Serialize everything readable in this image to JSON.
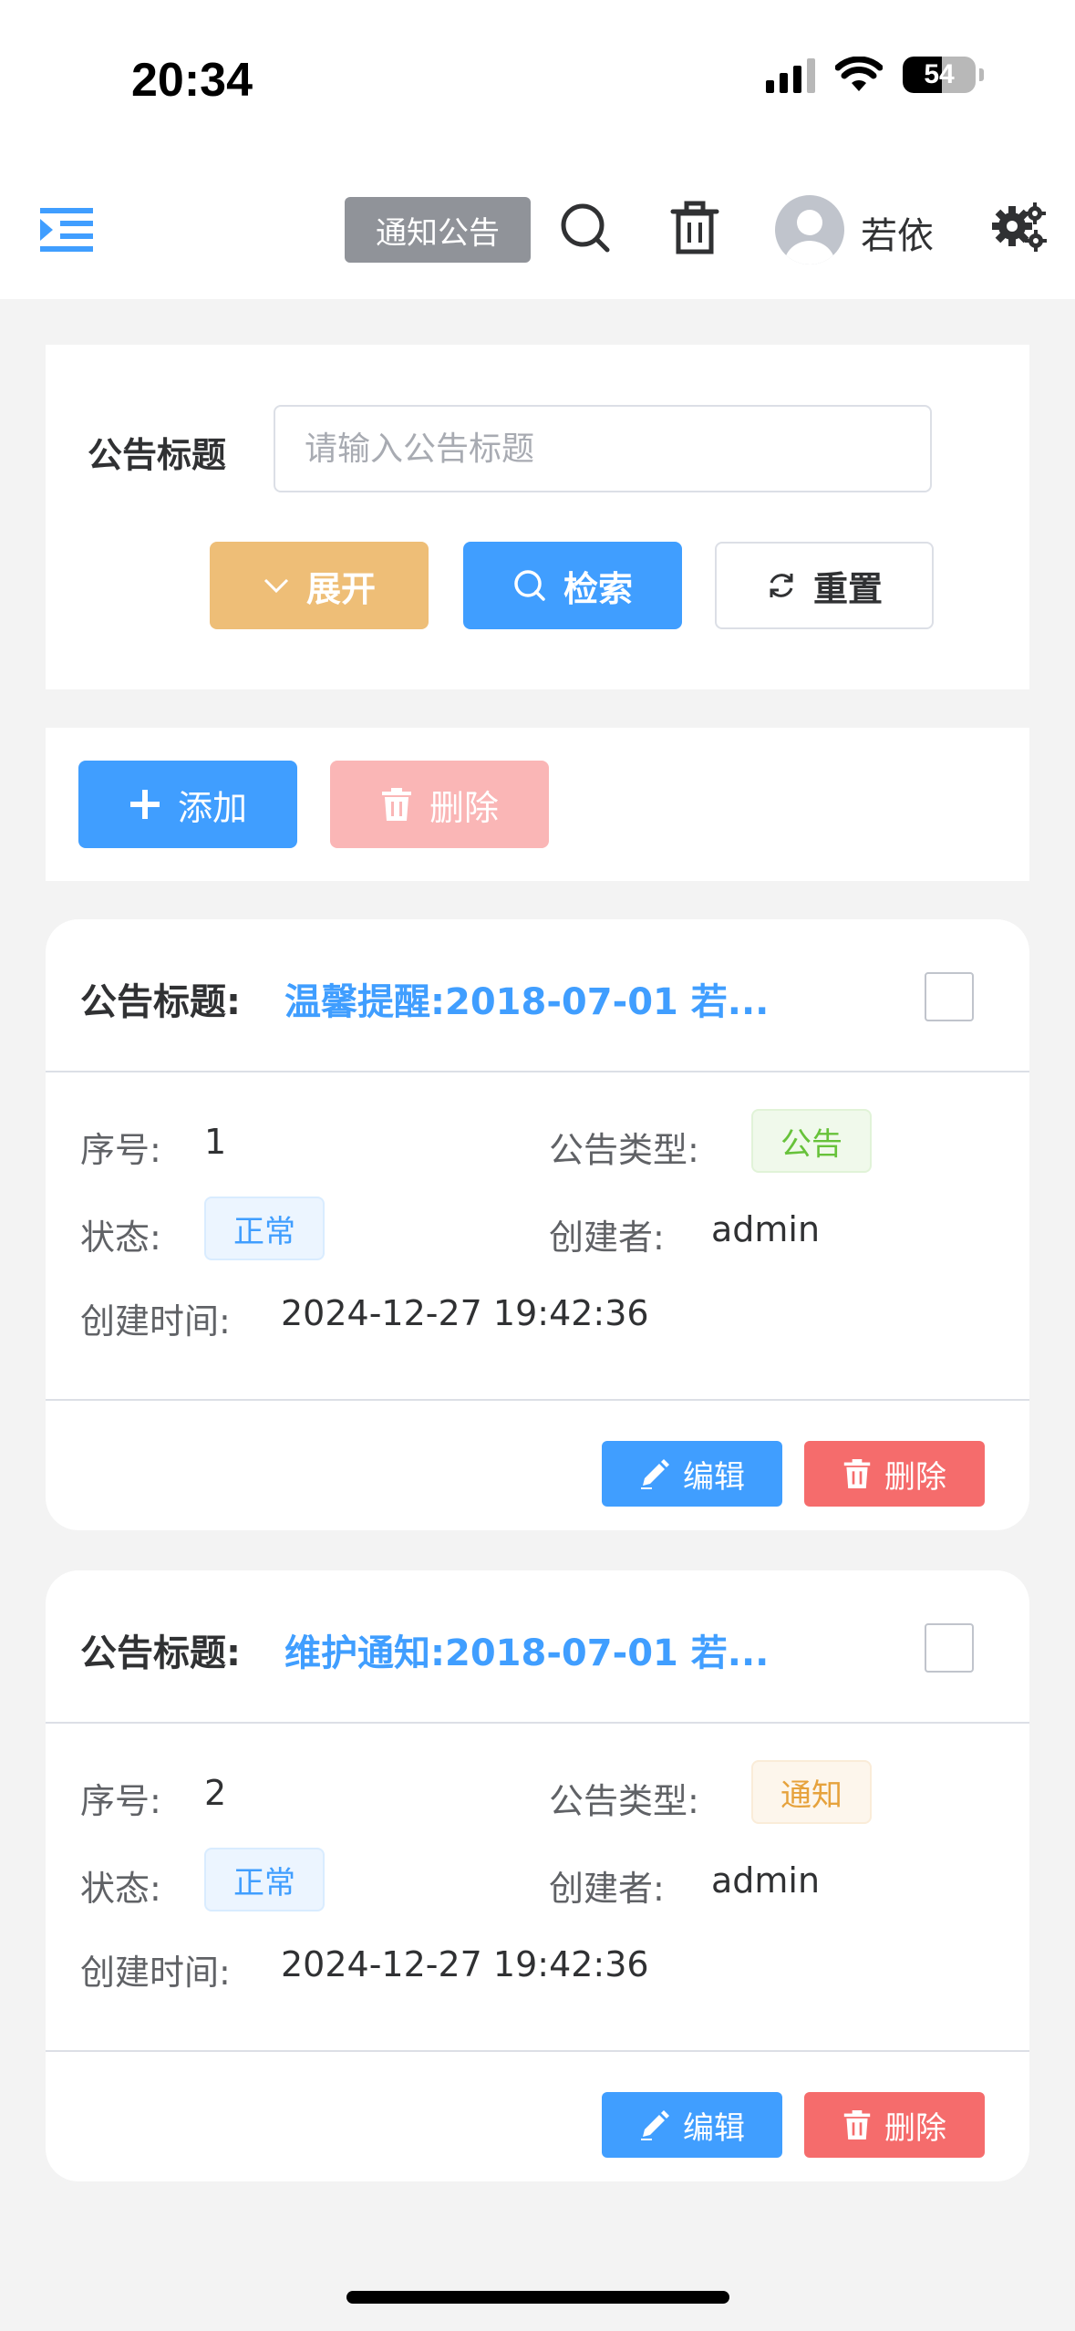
{
  "status_bar": {
    "time": "20:34",
    "battery_percent": "54",
    "battery_level": 0.54,
    "icons": [
      "signal-icon",
      "wifi-icon",
      "battery-icon"
    ]
  },
  "navbar": {
    "menu_icon": "hamburger-menu-icon",
    "page_tag": "通知公告",
    "search_icon": "search-icon",
    "trash_icon": "trash-icon",
    "user_name": "若依",
    "settings_icon": "gear-icon",
    "accent_color": "#409eff"
  },
  "search": {
    "label": "公告标题",
    "placeholder": "请输入公告标题",
    "value": "",
    "expand_label": "展开",
    "search_label": "检索",
    "reset_label": "重置"
  },
  "toolbar": {
    "add_label": "添加",
    "delete_label": "删除"
  },
  "labels": {
    "title": "公告标题:",
    "index": "序号:",
    "type": "公告类型:",
    "status": "状态:",
    "creator": "创建者:",
    "created_at": "创建时间:",
    "edit": "编辑",
    "delete": "删除"
  },
  "records": [
    {
      "title": "温馨提醒:2018-07-01 若...",
      "index": "1",
      "type": "公告",
      "type_color": "#67c23a",
      "status": "正常",
      "creator": "admin",
      "created_at": "2024-12-27 19:42:36",
      "checked": false
    },
    {
      "title": "维护通知:2018-07-01 若...",
      "index": "2",
      "type": "通知",
      "type_color": "#e6a23c",
      "status": "正常",
      "creator": "admin",
      "created_at": "2024-12-27 19:42:36",
      "checked": false
    }
  ]
}
